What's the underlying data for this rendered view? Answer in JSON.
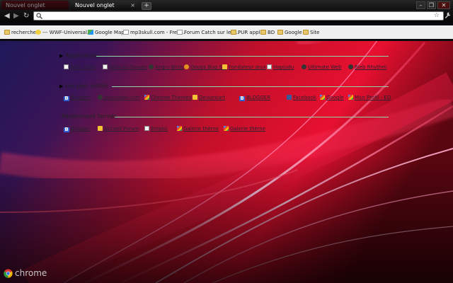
{
  "tabs": [
    {
      "label": "Nouvel onglet",
      "active": false
    },
    {
      "label": "Nouvel onglet",
      "active": true
    }
  ],
  "tab_close_glyph": "×",
  "new_tab_glyph": "+",
  "window_controls": {
    "minimize": "–",
    "maximize": "❐",
    "close": "✕"
  },
  "toolbar": {
    "back_glyph": "◀",
    "forward_glyph": "▶",
    "reload_glyph": "↻",
    "omnibox_value": "",
    "star_glyph": "☆",
    "wrench_glyph": "🔧"
  },
  "bookmarks": [
    {
      "label": "recherche",
      "icon": "folder-icon"
    },
    {
      "label": "--- WWF-Universal...",
      "icon": "wwf-icon"
    },
    {
      "label": "Google Maps",
      "icon": "google-maps-icon"
    },
    {
      "label": "mp3skull.com - Free...",
      "icon": "page-icon"
    },
    {
      "label": "Forum Catch sur leu...",
      "icon": "page-icon"
    },
    {
      "label": "PUR appli",
      "icon": "folder-icon"
    },
    {
      "label": "BD",
      "icon": "folder-icon"
    },
    {
      "label": "Google",
      "icon": "folder-icon"
    },
    {
      "label": "Site",
      "icon": "folder-icon"
    }
  ],
  "sections": {
    "apps": {
      "title": "Applications",
      "items": [
        {
          "label": "Web Store",
          "icon": "doc-icon"
        },
        {
          "label": "Tableau Google",
          "icon": "doc-icon"
        },
        {
          "label": "Angry Birds",
          "icon": "dark-icon"
        },
        {
          "label": "Ooops Bug Sol",
          "icon": "orange-icon"
        },
        {
          "label": "Fondateur Jeux",
          "icon": "yellow-icon"
        },
        {
          "label": "Hapjudu",
          "icon": "doc-icon"
        },
        {
          "label": "Ultimate Web",
          "icon": "dark-icon"
        },
        {
          "label": "Bleb Rhythm",
          "icon": "dark-icon"
        }
      ]
    },
    "most_visited": {
      "title": "Les plus visités",
      "items": [
        {
          "label": "Blogger",
          "icon": "blogger-icon"
        },
        {
          "label": "Jeuxvideo.com",
          "icon": "dark-icon"
        },
        {
          "label": "Chrome Themes",
          "icon": "google-icon"
        },
        {
          "label": "Deviantart",
          "icon": "yellow-icon"
        },
        {
          "label": "BLOGGER",
          "icon": "blogger-icon"
        },
        {
          "label": "Facebook",
          "icon": "facebook-icon"
        },
        {
          "label": "Google",
          "icon": "google-icon"
        },
        {
          "label": "Mon Profil - ED",
          "icon": "google-icon"
        }
      ]
    },
    "recent": {
      "title": "Récemment fermés",
      "items": [
        {
          "label": "Blogger",
          "icon": "blogger-icon"
        },
        {
          "label": "Accueil Forum",
          "icon": "yellow-icon"
        },
        {
          "label": "Emploi",
          "icon": "doc-icon"
        },
        {
          "label": "Galerie thème",
          "icon": "google-icon"
        },
        {
          "label": "Galerie thème",
          "icon": "google-icon"
        }
      ]
    }
  },
  "brand": {
    "wordmark": "chrome"
  },
  "colors": {
    "wallpaper_red": "#e0102e",
    "wallpaper_navy": "#1c1c5a",
    "section_rule": "#8fd6a8",
    "bookmark_bar": "#efefef"
  }
}
